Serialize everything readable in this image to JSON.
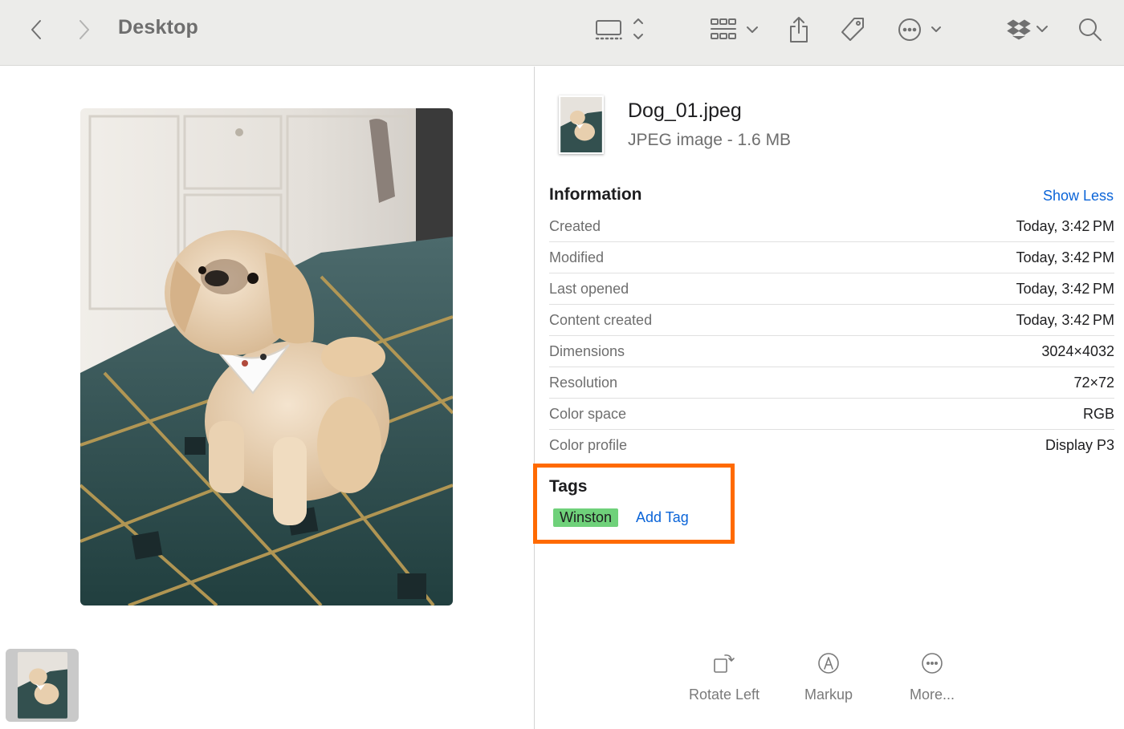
{
  "toolbar": {
    "title": "Desktop",
    "buttons": [
      "back",
      "forward",
      "gallery-view",
      "group-by",
      "share",
      "tag",
      "more-actions",
      "dropbox",
      "search"
    ]
  },
  "preview": {
    "image_alt": "Dog_01.jpeg",
    "thumbnail_alt": "Dog_01.jpeg"
  },
  "file": {
    "name": "Dog_01.jpeg",
    "kind": "JPEG image - 1.6 MB"
  },
  "information": {
    "heading": "Information",
    "toggle_label": "Show Less",
    "rows": [
      {
        "label": "Created",
        "value": "Today, 3:42 PM"
      },
      {
        "label": "Modified",
        "value": "Today, 3:42 PM"
      },
      {
        "label": "Last opened",
        "value": "Today, 3:42 PM"
      },
      {
        "label": "Content created",
        "value": "Today, 3:42 PM"
      },
      {
        "label": "Dimensions",
        "value": "3024×4032"
      },
      {
        "label": "Resolution",
        "value": "72×72"
      },
      {
        "label": "Color space",
        "value": "RGB"
      },
      {
        "label": "Color profile",
        "value": "Display P3"
      }
    ]
  },
  "tags": {
    "heading": "Tags",
    "items": [
      "Winston"
    ],
    "add_label": "Add Tag",
    "highlight_color": "#ff6a00",
    "tag_color": "#6fd17a"
  },
  "actions": {
    "rotate_left": "Rotate Left",
    "markup": "Markup",
    "more": "More..."
  },
  "colors": {
    "accent": "#0a64d8",
    "toolbar_bg": "#ececea"
  }
}
